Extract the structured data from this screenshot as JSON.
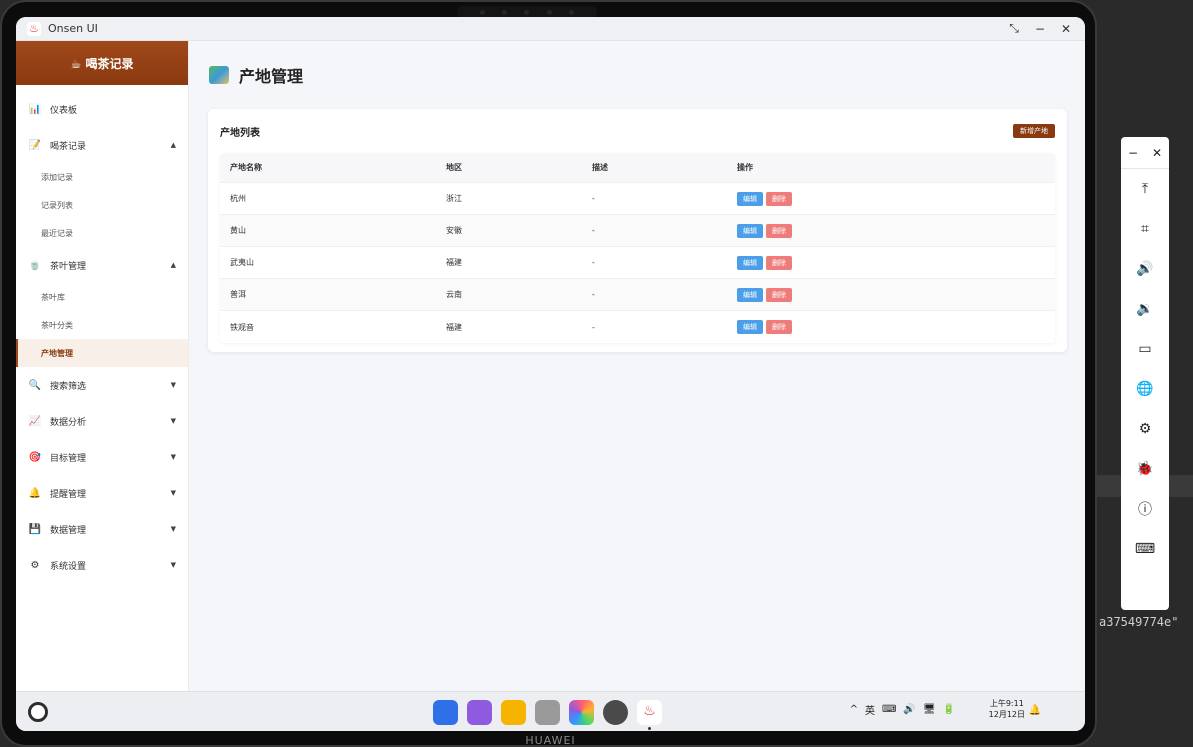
{
  "window": {
    "title": "Onsen UI",
    "controls": [
      "⤡",
      "−",
      "✕"
    ]
  },
  "sidebar": {
    "header": "☕ 喝茶记录",
    "items": [
      {
        "label": "仪表板",
        "icon": "📊"
      },
      {
        "label": "喝茶记录",
        "icon": "📝",
        "caret": "▲"
      },
      {
        "label": "茶叶管理",
        "icon": "🍵",
        "caret": "▲"
      },
      {
        "label": "搜索筛选",
        "icon": "🔍",
        "caret": "▼"
      },
      {
        "label": "数据分析",
        "icon": "📈",
        "caret": "▼"
      },
      {
        "label": "目标管理",
        "icon": "🎯",
        "caret": "▼"
      },
      {
        "label": "提醒管理",
        "icon": "🔔",
        "caret": "▼"
      },
      {
        "label": "数据管理",
        "icon": "💾",
        "caret": "▼"
      },
      {
        "label": "系统设置",
        "icon": "⚙",
        "caret": "▼"
      }
    ],
    "tea_record_sub": [
      "添加记录",
      "记录列表",
      "最近记录"
    ],
    "tea_manage_sub": [
      "茶叶库",
      "茶叶分类",
      "产地管理"
    ]
  },
  "main": {
    "page_title": "产地管理",
    "card_title": "产地列表",
    "add_button": "新增产地",
    "columns": [
      "产地名称",
      "地区",
      "描述",
      "操作"
    ],
    "rows": [
      {
        "name": "杭州",
        "region": "浙江",
        "desc": "-"
      },
      {
        "name": "黄山",
        "region": "安徽",
        "desc": "-"
      },
      {
        "name": "武夷山",
        "region": "福建",
        "desc": "-"
      },
      {
        "name": "普洱",
        "region": "云南",
        "desc": "-"
      },
      {
        "name": "铁观音",
        "region": "福建",
        "desc": "-"
      }
    ],
    "edit_label": "编辑",
    "delete_label": "删除"
  },
  "taskbar": {
    "time": "上午9:11",
    "date": "12月12日",
    "tray_icons": [
      "^",
      "英",
      "⌨",
      "🔊",
      "🖥",
      "🔋"
    ],
    "dock_apps": [
      {
        "name": "app-grid",
        "color": "#2f6fe8"
      },
      {
        "name": "multitask",
        "color": "#8e5be0"
      },
      {
        "name": "files",
        "color": "#f5b400"
      },
      {
        "name": "trash",
        "color": "#9a9a9a"
      },
      {
        "name": "gallery",
        "color": "#ff5a7a"
      },
      {
        "name": "settings",
        "color": "#4a4a4a"
      },
      {
        "name": "onsen",
        "color": "#ffffff",
        "label": "Onsen UI"
      }
    ]
  },
  "brand": "HUAWEI",
  "terminal_text": "a37549774e\""
}
